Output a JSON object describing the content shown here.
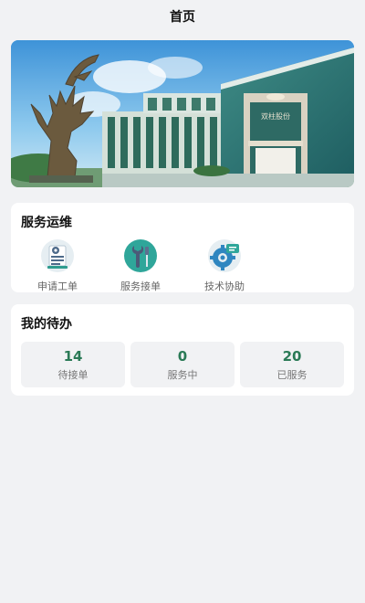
{
  "header": {
    "title": "首页"
  },
  "banner": {
    "building_sign": "双柱股份"
  },
  "ops": {
    "title": "服务运维",
    "items": [
      {
        "label": "申请工单",
        "icon": "document-gear-icon"
      },
      {
        "label": "服务接单",
        "icon": "wrench-screwdriver-icon"
      },
      {
        "label": "技术协助",
        "icon": "gear-chat-icon"
      }
    ]
  },
  "todo": {
    "title": "我的待办",
    "items": [
      {
        "count": "14",
        "label": "待接单"
      },
      {
        "count": "0",
        "label": "服务中"
      },
      {
        "count": "20",
        "label": "已服务"
      }
    ]
  },
  "colors": {
    "page_bg": "#f1f2f4",
    "card_bg": "#ffffff",
    "count_green": "#2a7a56",
    "icon_teal": "#2fa69a"
  }
}
